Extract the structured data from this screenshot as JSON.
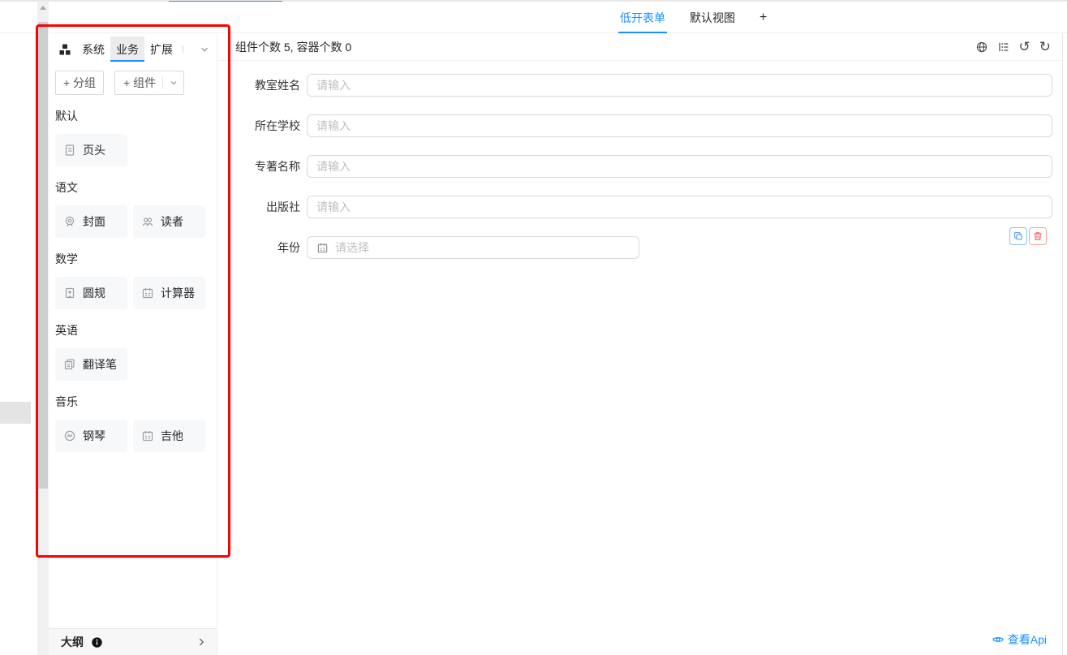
{
  "view_tabs": {
    "items": [
      {
        "label": "低开表单",
        "active": true
      },
      {
        "label": "默认视图",
        "active": false
      }
    ],
    "add_label": "+"
  },
  "sidebar": {
    "panel_tabs": {
      "system": "系统",
      "business": "业务",
      "extension": "扩展"
    },
    "toolbar": {
      "add_group": "+ 分组",
      "add_component": "+ 组件"
    },
    "groups": [
      {
        "title": "默认",
        "items": [
          {
            "label": "页头",
            "icon": "page-header-icon"
          }
        ]
      },
      {
        "title": "语文",
        "items": [
          {
            "label": "封面",
            "icon": "cover-medal-icon"
          },
          {
            "label": "读者",
            "icon": "readers-icon"
          }
        ]
      },
      {
        "title": "数学",
        "items": [
          {
            "label": "圆规",
            "icon": "compass-bookmark-icon"
          },
          {
            "label": "计算器",
            "icon": "calculator-icon"
          }
        ]
      },
      {
        "title": "英语",
        "items": [
          {
            "label": "翻译笔",
            "icon": "translate-pen-icon"
          }
        ]
      },
      {
        "title": "音乐",
        "items": [
          {
            "label": "钢琴",
            "icon": "piano-wave-icon"
          },
          {
            "label": "吉他",
            "icon": "guitar-calendar-icon"
          }
        ]
      }
    ],
    "outline_label": "大纲"
  },
  "canvas": {
    "summary": "组件个数 5, 容器个数 0",
    "header_icons": [
      "globe-icon",
      "outline-tree-icon",
      "undo-icon",
      "redo-icon"
    ],
    "fields": [
      {
        "label": "教室姓名",
        "placeholder": "请输入",
        "type": "input"
      },
      {
        "label": "所在学校",
        "placeholder": "请输入",
        "type": "input"
      },
      {
        "label": "专著名称",
        "placeholder": "请输入",
        "type": "input"
      },
      {
        "label": "出版社",
        "placeholder": "请输入",
        "type": "input"
      },
      {
        "label": "年份",
        "placeholder": "请选择",
        "type": "date"
      }
    ],
    "undo_glyph": "↺",
    "redo_glyph": "↻",
    "api_link_label": "查看Api"
  },
  "colors": {
    "accent": "#1890ff",
    "annotation_box": "#ff0000",
    "copy_button": "#4096ff",
    "delete_button": "#f5595c",
    "browser_accent": "#4d7fbe"
  }
}
